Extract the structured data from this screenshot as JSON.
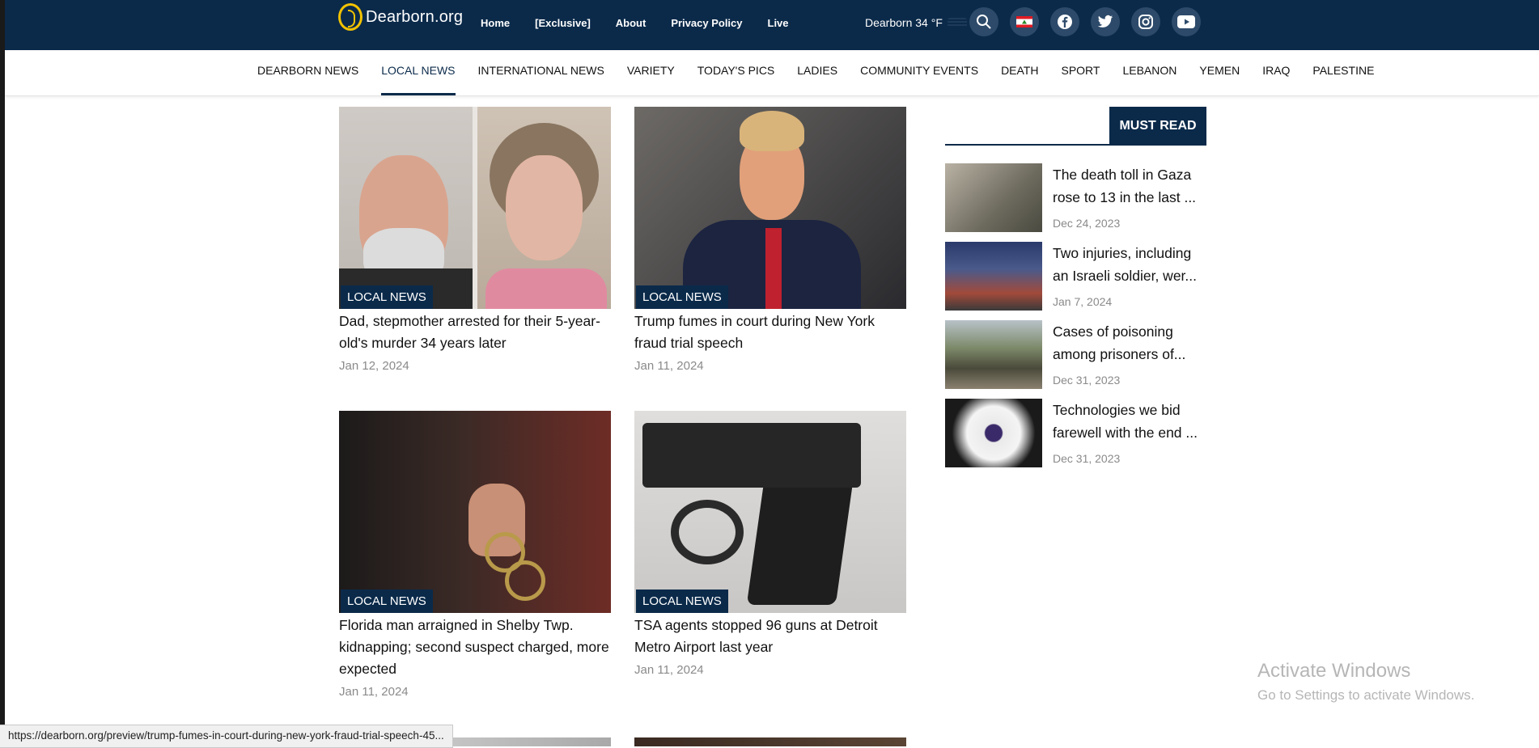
{
  "site": {
    "logo_text": "Dearborn.org"
  },
  "topnav": [
    "Home",
    "[Exclusive]",
    "About",
    "Privacy Policy",
    "Live"
  ],
  "weather": {
    "text": "Dearborn 34 °F"
  },
  "topbar_icons": [
    "search-icon",
    "lebanon-flag-icon",
    "facebook-icon",
    "twitter-icon",
    "instagram-icon",
    "youtube-icon"
  ],
  "categories": [
    {
      "label": "DEARBORN NEWS"
    },
    {
      "label": "LOCAL NEWS",
      "active": true
    },
    {
      "label": "INTERNATIONAL NEWS"
    },
    {
      "label": "VARIETY"
    },
    {
      "label": "TODAY'S PICS"
    },
    {
      "label": "LADIES"
    },
    {
      "label": "COMMUNITY EVENTS"
    },
    {
      "label": "DEATH"
    },
    {
      "label": "SPORT"
    },
    {
      "label": "LEBANON"
    },
    {
      "label": "YEMEN"
    },
    {
      "label": "IRAQ"
    },
    {
      "label": "PALESTINE"
    }
  ],
  "articles": [
    {
      "badge": "LOCAL NEWS",
      "title": "Dad, stepmother arrested for their 5-year-old's murder 34 years later",
      "date": "Jan 12, 2024"
    },
    {
      "badge": "LOCAL NEWS",
      "title": "Trump fumes in court during New York fraud trial speech",
      "date": "Jan 11, 2024"
    },
    {
      "badge": "LOCAL NEWS",
      "title": "Florida man arraigned in Shelby Twp. kidnapping; second suspect charged, more expected",
      "date": "Jan 11, 2024"
    },
    {
      "badge": "LOCAL NEWS",
      "title": "TSA agents stopped 96 guns at Detroit Metro Airport last year",
      "date": "Jan 11, 2024"
    }
  ],
  "sidebar": {
    "heading": "MUST READ",
    "items": [
      {
        "title": "The death toll in Gaza rose to 13 in the last ...",
        "date": "Dec 24, 2023"
      },
      {
        "title": "Two injuries, including an Israeli soldier, wer...",
        "date": "Jan 7, 2024"
      },
      {
        "title": "Cases of poisoning among prisoners of...",
        "date": "Dec 31, 2023"
      },
      {
        "title": "Technologies we bid farewell with the end ...",
        "date": "Dec 31, 2023"
      }
    ]
  },
  "watermark": {
    "line1": "Activate Windows",
    "line2": "Go to Settings to activate Windows."
  },
  "status_url": "https://dearborn.org/preview/trump-fumes-in-court-during-new-york-fraud-trial-speech-45..."
}
